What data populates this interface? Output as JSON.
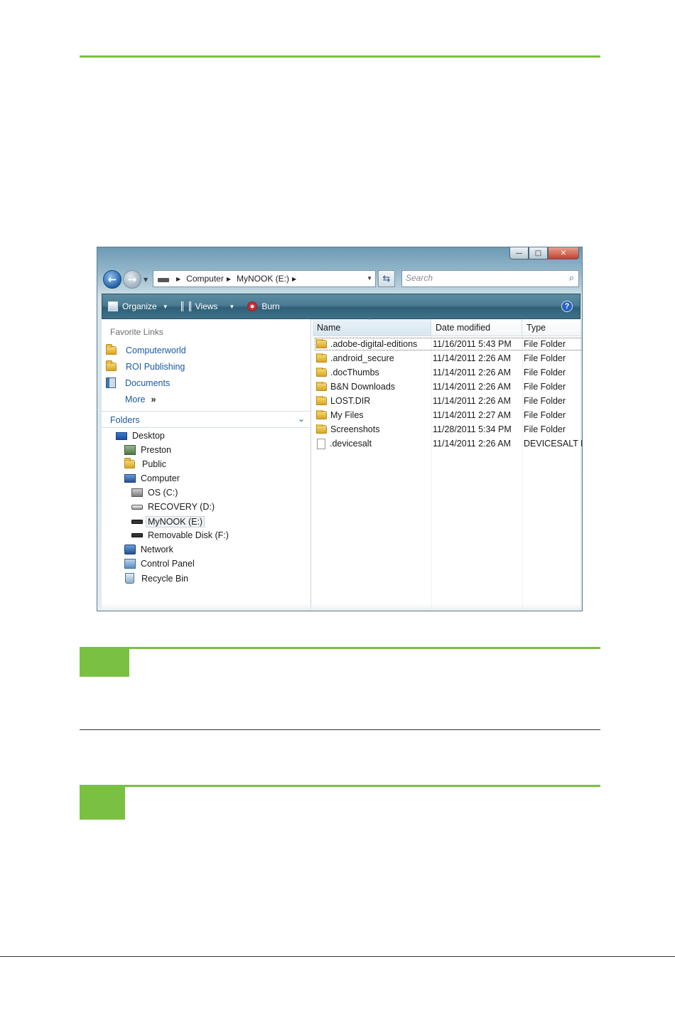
{
  "window": {
    "caption_buttons": {
      "minimize": "—",
      "maximize": "□",
      "close": "✕"
    },
    "address": {
      "crumbs": [
        "Computer",
        "MyNOOK (E:)"
      ]
    },
    "search": {
      "placeholder": "Search"
    },
    "toolbar": {
      "organize": "Organize",
      "views": "Views",
      "burn": "Burn",
      "help": "?"
    },
    "favorite_links": {
      "title": "Favorite Links",
      "items": [
        "Computerworld",
        "ROI Publishing",
        "Documents"
      ],
      "more": "More",
      "more_chevron": "»"
    },
    "folders": {
      "title": "Folders",
      "tree": [
        "Desktop",
        "Preston",
        "Public",
        "Computer",
        "OS (C:)",
        "RECOVERY (D:)",
        "MyNOOK (E:)",
        "Removable Disk (F:)",
        "Network",
        "Control Panel",
        "Recycle Bin"
      ]
    },
    "columns": {
      "name": "Name",
      "date": "Date modified",
      "type": "Type"
    },
    "files": [
      {
        "name": ".adobe-digital-editions",
        "date": "11/16/2011 5:43 PM",
        "type": "File Folder"
      },
      {
        "name": ".android_secure",
        "date": "11/14/2011 2:26 AM",
        "type": "File Folder"
      },
      {
        "name": ".docThumbs",
        "date": "11/14/2011 2:26 AM",
        "type": "File Folder"
      },
      {
        "name": "B&N Downloads",
        "date": "11/14/2011 2:26 AM",
        "type": "File Folder"
      },
      {
        "name": "LOST.DIR",
        "date": "11/14/2011 2:26 AM",
        "type": "File Folder"
      },
      {
        "name": "My Files",
        "date": "11/14/2011 2:27 AM",
        "type": "File Folder"
      },
      {
        "name": "Screenshots",
        "date": "11/28/2011 5:34 PM",
        "type": "File Folder"
      },
      {
        "name": ".devicesalt",
        "date": "11/14/2011 2:26 AM",
        "type": "DEVICESALT File"
      }
    ]
  },
  "colors": {
    "accent_green": "#7ac143",
    "toolbar_teal": "#3f7189",
    "link_blue": "#1a5aa0"
  },
  "icons": [
    "back-arrow-icon",
    "forward-arrow-icon",
    "drive-icon",
    "refresh-icon",
    "search-icon",
    "folder-icon",
    "document-icon",
    "desktop-icon",
    "user-icon",
    "computer-icon",
    "drive-os-icon",
    "network-icon",
    "control-panel-icon",
    "recycle-bin-icon",
    "file-icon",
    "help-icon"
  ]
}
